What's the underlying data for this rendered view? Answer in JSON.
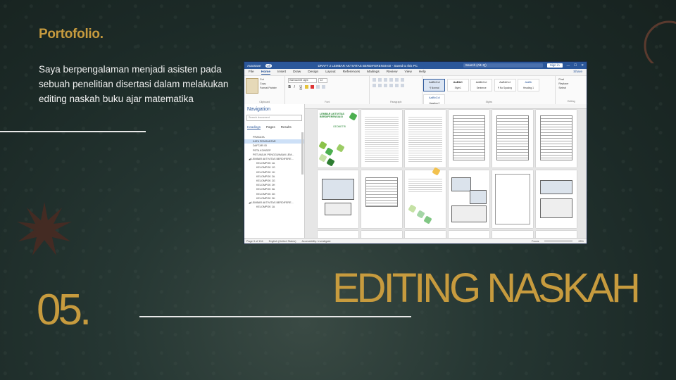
{
  "slide": {
    "brand": "Portofolio.",
    "description": "Saya berpengalaman menjadi asisten pada sebuah penelitian disertasi dalam melakukan editing naskah buku ajar matematika",
    "number": "05.",
    "title": "EDITING NASKAH",
    "colors": {
      "accent": "#c79b3e",
      "background": "#1f2d2a",
      "line": "#e8e8e8"
    }
  },
  "word": {
    "autosave": "AutoSave",
    "autosave_state": "Off",
    "doc_title": "DRAFT 2 LEMBAR AKTIVITAS BERDIFERENSIASI - Saved to this PC",
    "search_placeholder": "Search (Alt+Q)",
    "sign_in": "Sign in",
    "menu": [
      "File",
      "Home",
      "Insert",
      "Draw",
      "Design",
      "Layout",
      "References",
      "Mailings",
      "Review",
      "View",
      "Help"
    ],
    "share": "Share",
    "ribbon": {
      "paste": "Paste",
      "cut": "Cut",
      "copy": "Copy",
      "format_painter": "Format Painter",
      "clipboard_label": "Clipboard",
      "font_name": "Bahnschrift Light",
      "font_size": "12",
      "font_label": "Font",
      "paragraph_label": "Paragraph",
      "styles": [
        {
          "preview": "AaBbCcI",
          "name": "¶ Normal"
        },
        {
          "preview": "AaBbC",
          "name": "Style1"
        },
        {
          "preview": "AaBbCcI",
          "name": "Sentence"
        },
        {
          "preview": "AaBbCcI",
          "name": "¶ No Spacing"
        },
        {
          "preview": "AaBb",
          "name": "Heading 1"
        },
        {
          "preview": "AaBbCcI",
          "name": "Heading 2"
        }
      ],
      "styles_label": "Styles",
      "find": "Find",
      "replace": "Replace",
      "select": "Select",
      "editing_label": "Editing"
    },
    "navigation": {
      "title": "Navigation",
      "search_placeholder": "Search document",
      "tabs": [
        "Headings",
        "Pages",
        "Results"
      ],
      "items": [
        {
          "label": "PRAKATA",
          "level": 2,
          "selected": false
        },
        {
          "label": "KATA PENGANTAR",
          "level": 2,
          "selected": true
        },
        {
          "label": "DAFTAR ISI",
          "level": 2,
          "selected": false
        },
        {
          "label": "PETA KONSEP",
          "level": 2,
          "selected": false
        },
        {
          "label": "PETUNJUK PENGGUNAAN LEM...",
          "level": 2,
          "selected": false
        },
        {
          "label": "◢ LEMBAR AKTIVITAS BERDIFERE...",
          "level": 1,
          "selected": false
        },
        {
          "label": "KELOMPOK 1A",
          "level": 3,
          "selected": false
        },
        {
          "label": "KELOMPOK 1G",
          "level": 3,
          "selected": false
        },
        {
          "label": "KELOMPOK 1H",
          "level": 3,
          "selected": false
        },
        {
          "label": "KELOMPOK 2A",
          "level": 3,
          "selected": false
        },
        {
          "label": "KELOMPOK 2G",
          "level": 3,
          "selected": false
        },
        {
          "label": "KELOMPOK 2H",
          "level": 3,
          "selected": false
        },
        {
          "label": "KELOMPOK 3A",
          "level": 3,
          "selected": false
        },
        {
          "label": "KELOMPOK 3G",
          "level": 3,
          "selected": false
        },
        {
          "label": "KELOMPOK 3H",
          "level": 3,
          "selected": false
        },
        {
          "label": "◢ LEMBAR AKTIVITAS BERDIFERE...",
          "level": 1,
          "selected": false
        },
        {
          "label": "KELOMPOK 1A",
          "level": 3,
          "selected": false
        }
      ]
    },
    "cover": {
      "title_line1": "LEMBAR AKTIVITAS",
      "title_line2": "BERDIFERENSIASI",
      "subtitle": "GEOMETRI"
    },
    "status": {
      "page": "Page 3 of 104",
      "language": "English (United States)",
      "accessibility": "Accessibility: Investigate",
      "focus": "Focus",
      "zoom": "28%"
    }
  }
}
